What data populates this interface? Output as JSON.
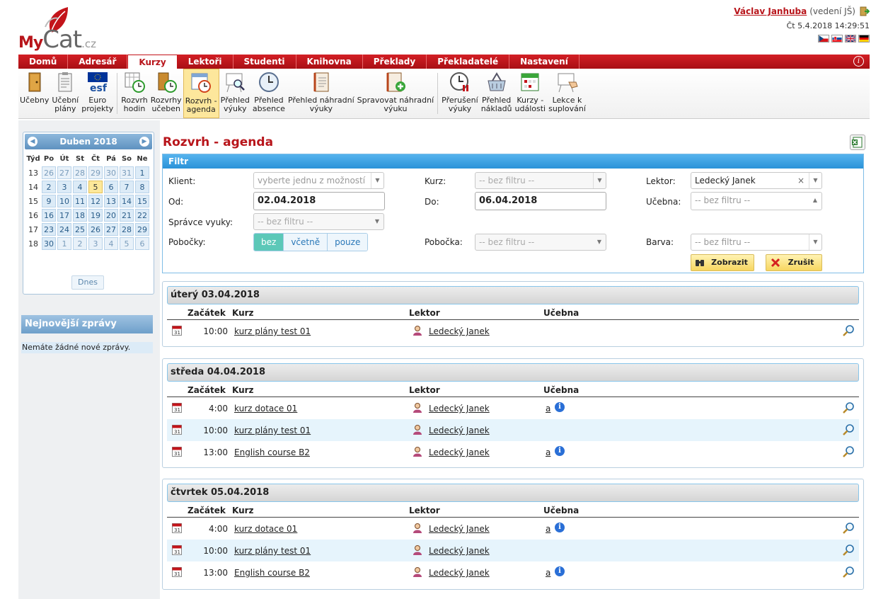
{
  "brand": {
    "my": "My",
    "cat": "Cat",
    "cz": ".cz"
  },
  "user": {
    "name": "Václav Janhuba",
    "role": "(vedení JŠ)",
    "datetime": "Čt 5.4.2018 14:29:51"
  },
  "nav": [
    "Domů",
    "Adresář",
    "Kurzy",
    "Lektoři",
    "Studenti",
    "Knihovna",
    "Překlady",
    "Překladatelé",
    "Nastavení"
  ],
  "nav_active": "Kurzy",
  "info_glyph": "i",
  "toolbar": [
    {
      "label1": "Učebny",
      "label2": "",
      "icon": "door-icon"
    },
    {
      "label1": "Učební",
      "label2": "plány",
      "icon": "clipboard-icon"
    },
    {
      "label1": "Euro",
      "label2": "projekty",
      "icon": "esf-logo-icon"
    },
    {
      "label1": "Rozvrh",
      "label2": "hodin",
      "icon": "calendar-clock-icon"
    },
    {
      "label1": "Rozvrhy",
      "label2": "učeben",
      "icon": "door-clock-icon"
    },
    {
      "label1": "Rozvrh -",
      "label2": "agenda",
      "icon": "agenda-clock-icon"
    },
    {
      "label1": "Přehled",
      "label2": "výuky",
      "icon": "board-magnifier-icon"
    },
    {
      "label1": "Přehled",
      "label2": "absence",
      "icon": "clock-icon"
    },
    {
      "label1": "Přehled náhradní",
      "label2": "výuky",
      "icon": "notebook-icon"
    },
    {
      "label1": "Spravovat náhradní",
      "label2": "výuku",
      "icon": "notebook-add-icon"
    },
    {
      "label1": "Přerušení",
      "label2": "výuky",
      "icon": "clock-pause-icon"
    },
    {
      "label1": "Přehled",
      "label2": "nákladů",
      "icon": "basket-icon"
    },
    {
      "label1": "Kurzy -",
      "label2": "události",
      "icon": "calendar-events-icon"
    },
    {
      "label1": "Lekce k",
      "label2": "suplování",
      "icon": "board-hand-icon"
    }
  ],
  "calendar": {
    "title": "Duben 2018",
    "prev_glyph": "◀",
    "next_glyph": "▶",
    "headers": [
      "Týd",
      "Po",
      "Út",
      "St",
      "Čt",
      "Pá",
      "So",
      "Ne"
    ],
    "weeks": [
      {
        "wk": "13",
        "days": [
          "26",
          "27",
          "28",
          "29",
          "30",
          "31",
          "1"
        ]
      },
      {
        "wk": "14",
        "days": [
          "2",
          "3",
          "4",
          "5",
          "6",
          "7",
          "8"
        ]
      },
      {
        "wk": "15",
        "days": [
          "9",
          "10",
          "11",
          "12",
          "13",
          "14",
          "15"
        ]
      },
      {
        "wk": "16",
        "days": [
          "16",
          "17",
          "18",
          "19",
          "20",
          "21",
          "22"
        ]
      },
      {
        "wk": "17",
        "days": [
          "23",
          "24",
          "25",
          "26",
          "27",
          "28",
          "29"
        ]
      },
      {
        "wk": "18",
        "days": [
          "30",
          "1",
          "2",
          "3",
          "4",
          "5",
          "6"
        ]
      }
    ],
    "today_button": "Dnes"
  },
  "news": {
    "title": "Nejnovější zprávy",
    "body": "Nemáte žádné nové zprávy."
  },
  "page_title": "Rozvrh - agenda",
  "filter": {
    "title": "Filtr",
    "klient_label": "Klient:",
    "klient_value": "vyberte jednu z možností",
    "kurz_label": "Kurz:",
    "kurz_value": "-- bez filtru --",
    "lektor_label": "Lektor:",
    "lektor_value": "Ledecký Janek",
    "od_label": "Od:",
    "od_value": "02.04.2018",
    "do_label": "Do:",
    "do_value": "06.04.2018",
    "ucebna_label": "Učebna:",
    "ucebna_value": "-- bez filtru --",
    "spravce_label": "Správce vyuky:",
    "spravce_value": "-- bez filtru --",
    "pobocky_label": "Pobočky:",
    "pobocky_options": [
      "bez",
      "včetně",
      "pouze"
    ],
    "pobocka_label": "Pobočka:",
    "pobocka_value": "-- bez filtru --",
    "barva_label": "Barva:",
    "barva_value": "-- bez filtru --",
    "show_button": "Zobrazit",
    "cancel_button": "Zrušit",
    "clear_glyph": "×",
    "arrow_glyph": "▼",
    "arrow_up_glyph": "▲"
  },
  "columns": {
    "start": "Začátek",
    "course": "Kurz",
    "lector": "Lektor",
    "room": "Učebna"
  },
  "calendar_icon_text": "31",
  "room_info_glyph": "i",
  "days": [
    {
      "title": "úterý 03.04.2018",
      "rows": [
        {
          "time": "10:00",
          "course": "kurz plány test 01",
          "lector": "Ledecký Janek",
          "room": ""
        }
      ]
    },
    {
      "title": "středa 04.04.2018",
      "rows": [
        {
          "time": "4:00",
          "course": "kurz dotace 01",
          "lector": "Ledecký Janek",
          "room": "a"
        },
        {
          "time": "10:00",
          "course": "kurz plány test 01",
          "lector": "Ledecký Janek",
          "room": ""
        },
        {
          "time": "13:00",
          "course": "English course B2",
          "lector": "Ledecký Janek",
          "room": "a"
        }
      ]
    },
    {
      "title": "čtvrtek 05.04.2018",
      "rows": [
        {
          "time": "4:00",
          "course": "kurz dotace 01",
          "lector": "Ledecký Janek",
          "room": "a"
        },
        {
          "time": "10:00",
          "course": "kurz plány test 01",
          "lector": "Ledecký Janek",
          "room": ""
        },
        {
          "time": "13:00",
          "course": "English course B2",
          "lector": "Ledecký Janek",
          "room": "a"
        }
      ]
    }
  ]
}
